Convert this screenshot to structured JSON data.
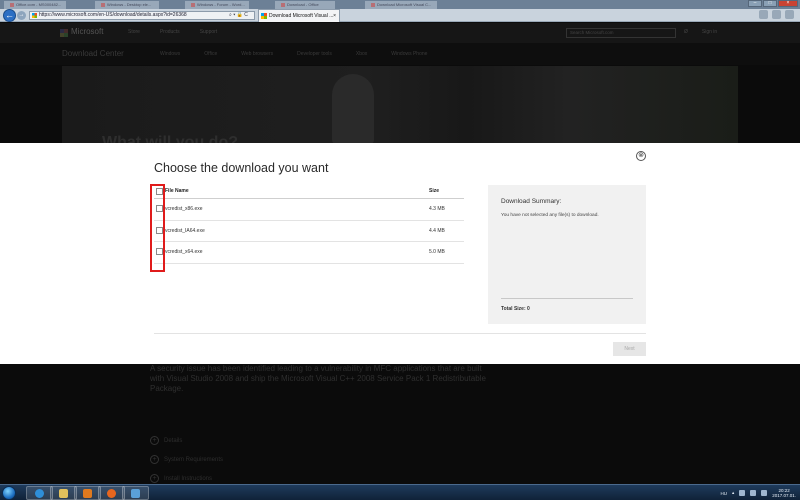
{
  "browser": {
    "ghost_tabs": [
      "Office.com - MS000482...",
      "Windows - Desktop ele...",
      "Windows - Forum - Word...",
      "Download - Office",
      "Download Microsoft Visual C..."
    ],
    "address": "https://www.microsoft.com/en-US/download/details.aspx?id=26368",
    "address_controls": "⌕ ▾ 🔒 C",
    "active_tab": "Download Microsoft Visual ...",
    "tab_close": "×"
  },
  "site": {
    "brand": "Microsoft",
    "top_nav": [
      "Store",
      "Products",
      "Support"
    ],
    "search_placeholder": "Search Microsoft.com",
    "top_right": [
      "Ø",
      "Sign in"
    ],
    "download_center": "Download Center",
    "dc_nav": [
      "Windows",
      "Office",
      "Web browsers",
      "Developer tools",
      "Xbox",
      "Windows Phone"
    ],
    "hero_title": "What will you do?",
    "description": "A security issue has been identified leading to a vulnerability in MFC applications that are built with Visual Studio 2008 and ship the Microsoft Visual C++ 2008 Service Pack 1 Redistributable Package.",
    "expanders": [
      "Details",
      "System Requirements",
      "Install Instructions"
    ]
  },
  "modal": {
    "title": "Choose the download you want",
    "close_icon": "⊗",
    "columns": {
      "name": "File Name",
      "size": "Size"
    },
    "files": [
      {
        "name": "vcredist_x86.exe",
        "size": "4.3 MB"
      },
      {
        "name": "vcredist_IA64.exe",
        "size": "4.4 MB"
      },
      {
        "name": "vcredist_x64.exe",
        "size": "5.0 MB"
      }
    ],
    "summary": {
      "title": "Download Summary:",
      "message": "You have not selected any file(s) to download.",
      "total": "Total Size: 0"
    },
    "next_label": "Next"
  },
  "taskbar": {
    "lang": "HU",
    "time": "20:22",
    "date": "2017.07.01."
  },
  "colors": {
    "highlight": "#e01b1b",
    "taskbar": "#1f3b5c"
  }
}
